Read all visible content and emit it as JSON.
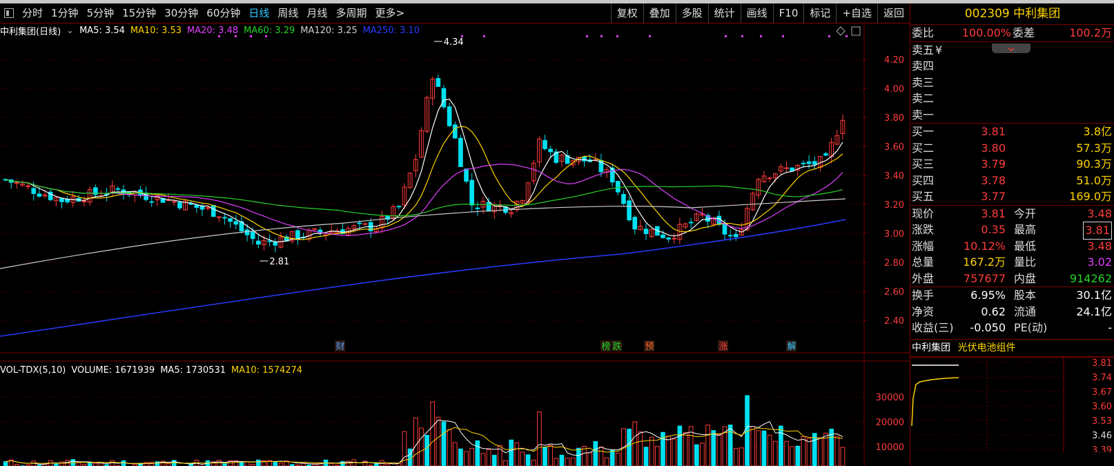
{
  "toolbar": {
    "left_items": [
      "分时",
      "1分钟",
      "5分钟",
      "15分钟",
      "30分钟",
      "60分钟",
      "日线",
      "周线",
      "月线",
      "多周期",
      "更多>"
    ],
    "active_item": "日线",
    "right_items": [
      "复权",
      "叠加",
      "多股",
      "统计",
      "画线",
      "F10",
      "标记",
      "+自选",
      "返回"
    ]
  },
  "chart": {
    "title": "中利集团(日线)",
    "ma": [
      {
        "label": "MA5: 3.54",
        "color": "#ffffff"
      },
      {
        "label": "MA10: 3.53",
        "color": "#ffd400"
      },
      {
        "label": "MA20: 3.48",
        "color": "#e040ff"
      },
      {
        "label": "MA60: 3.29",
        "color": "#27d327"
      },
      {
        "label": "MA120: 3.25",
        "color": "#cfcfcf"
      },
      {
        "label": "MA250: 3.10",
        "color": "#2a3cff"
      }
    ],
    "high_label": "4.34",
    "low_label": "2.81",
    "price_ticks": [
      "4.20",
      "4.00",
      "3.80",
      "3.60",
      "3.40",
      "3.20",
      "3.00",
      "2.80",
      "2.60",
      "2.40"
    ],
    "event_markers": [
      {
        "text": "财",
        "color": "#5aa0ff"
      },
      {
        "text": "榜",
        "color": "#27d327"
      },
      {
        "text": "跌",
        "color": "#27d327"
      },
      {
        "text": "预",
        "color": "#ff6a2a"
      },
      {
        "text": "涨",
        "color": "#ff3c3c"
      },
      {
        "text": "解",
        "color": "#33c8ff"
      }
    ]
  },
  "volume": {
    "title": "VOL-TDX(5,10)",
    "items": [
      {
        "label": "VOLUME: 1671939",
        "color": "#ffffff"
      },
      {
        "label": "MA5: 1730531",
        "color": "#ffffff"
      },
      {
        "label": "MA10: 1574274",
        "color": "#ffd400"
      }
    ],
    "ticks": [
      "30000",
      "20000",
      "10000"
    ]
  },
  "panel": {
    "code": "002309",
    "name": "中利集团",
    "weibi_label": "委比",
    "weibi": "100.00%",
    "weicha_label": "委差",
    "weicha": "100.2万",
    "sell": [
      {
        "label": "卖五",
        "extra": "¥"
      },
      {
        "label": "卖四",
        "extra": ""
      },
      {
        "label": "卖三",
        "extra": ""
      },
      {
        "label": "卖二",
        "extra": ""
      },
      {
        "label": "卖一",
        "extra": ""
      }
    ],
    "buy": [
      {
        "label": "买一",
        "price": "3.81",
        "vol": "3.8亿"
      },
      {
        "label": "买二",
        "price": "3.80",
        "vol": "57.3万"
      },
      {
        "label": "买三",
        "price": "3.79",
        "vol": "90.3万"
      },
      {
        "label": "买四",
        "price": "3.78",
        "vol": "51.0万"
      },
      {
        "label": "买五",
        "price": "3.77",
        "vol": "169.0万"
      }
    ],
    "stats": [
      {
        "l1": "现价",
        "v1": "3.81",
        "c1": "red",
        "l2": "今开",
        "v2": "3.48",
        "c2": "red"
      },
      {
        "l1": "涨跌",
        "v1": "0.35",
        "c1": "red",
        "l2": "最高",
        "v2": "3.81",
        "c2": "red"
      },
      {
        "l1": "涨幅",
        "v1": "10.12%",
        "c1": "red",
        "l2": "最低",
        "v2": "3.48",
        "c2": "red"
      },
      {
        "l1": "总量",
        "v1": "167.2万",
        "c1": "yel",
        "l2": "量比",
        "v2": "3.02",
        "c2": "mag"
      },
      {
        "l1": "外盘",
        "v1": "757677",
        "c1": "red",
        "l2": "内盘",
        "v2": "914262",
        "c2": "grn"
      }
    ],
    "stats2": [
      {
        "l1": "换手",
        "v1": "6.95%",
        "l2": "股本",
        "v2": "30.1亿"
      },
      {
        "l1": "净资",
        "v1": "0.62",
        "l2": "流通",
        "v2": "24.1亿"
      },
      {
        "l1": "收益(三)",
        "v1": "-0.050",
        "l2": "PE(动)",
        "v2": "-"
      }
    ],
    "mini_name": "中利集团",
    "mini_sector": "光伏电池组件",
    "mini_ticks": [
      "3.81",
      "3.74",
      "3.67",
      "3.60",
      "3.53",
      "3.46",
      "3.39"
    ]
  },
  "colors": {
    "up": "#ff3c3c",
    "down": "#00e0f0",
    "grid": "#7a0000"
  }
}
